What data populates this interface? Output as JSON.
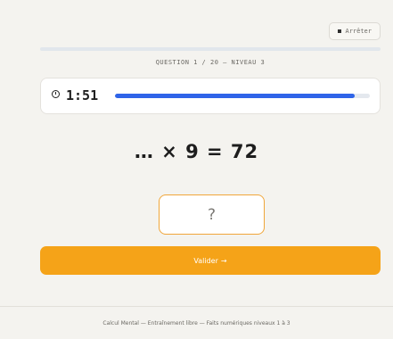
{
  "header": {
    "stop_label": "Arrêter",
    "stop_icon": "stop-square-icon",
    "question_label": "QUESTION 1 / 20 — NIVEAU 3",
    "question_progress": 0
  },
  "timer": {
    "icon": "timer-icon",
    "value": "1:51",
    "remaining_fraction": 0.94,
    "bar_color": "#2f64e8"
  },
  "exercise": {
    "equation": "… × 9 = 72"
  },
  "answer": {
    "value": "?",
    "border_color": "#f0a63a"
  },
  "actions": {
    "validate_label": "Valider",
    "validate_arrow": "→",
    "validate_color": "#f5a318"
  },
  "footer": {
    "text": "Calcul Mental — Entraînement libre — Faits numériques niveaux 1 à 3"
  }
}
